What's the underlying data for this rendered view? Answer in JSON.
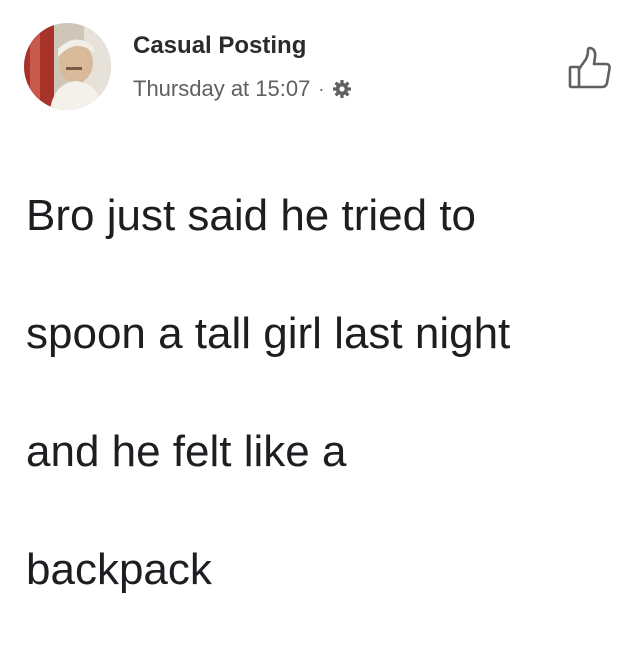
{
  "post": {
    "author": "Casual Posting",
    "timestamp": "Thursday at 15:07",
    "separator": "·",
    "privacy_icon": "gear-icon",
    "action_icon": "thumbs-up-icon",
    "text_lines": [
      "Bro just said he tried to",
      "spoon a tall girl last night",
      "and he felt like a",
      "backpack"
    ]
  },
  "colors": {
    "text": "#1c1e21",
    "meta": "#5f6062",
    "background": "#ffffff"
  }
}
